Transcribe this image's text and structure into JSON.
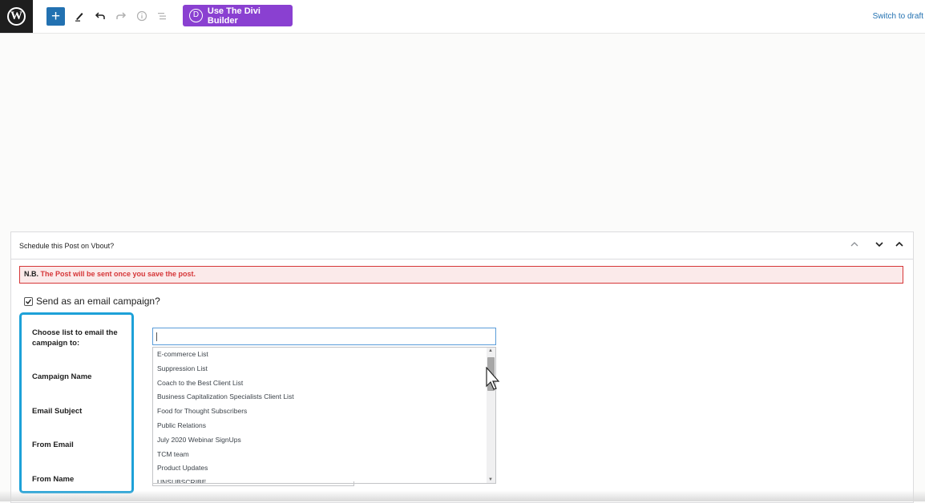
{
  "toolbar": {
    "wp_logo": "W",
    "add_icon": "+",
    "divi_letter": "D",
    "divi_label": "Use The Divi Builder",
    "switch_label": "Switch to draft"
  },
  "metabox": {
    "title": "Schedule this Post on Vbout?",
    "notice_prefix": "N.B.",
    "notice_message": "The Post will be sent once you save the post.",
    "campaign_label": "Send as an email campaign?",
    "campaign_checked": true,
    "fields": {
      "list_label": "Choose list to email the campaign to:",
      "campaign_name": "Campaign Name",
      "email_subject": "Email Subject",
      "from_email": "From Email",
      "from_name": "From Name"
    },
    "list_search_value": "",
    "list_options": [
      "E-commerce List",
      "Suppression List",
      "Coach to the Best Client List",
      "Business Capitalization Specialists Client List",
      "Food for Thought Subscribers",
      "Public Relations",
      "July 2020 Webinar SignUps",
      "TCM team",
      "Product Updates",
      "UNSUBSCRIBE"
    ]
  },
  "colors": {
    "accent": "#2271b1",
    "divi": "#8a40d1",
    "error": "#d63638",
    "highlight": "#1da1d8"
  }
}
